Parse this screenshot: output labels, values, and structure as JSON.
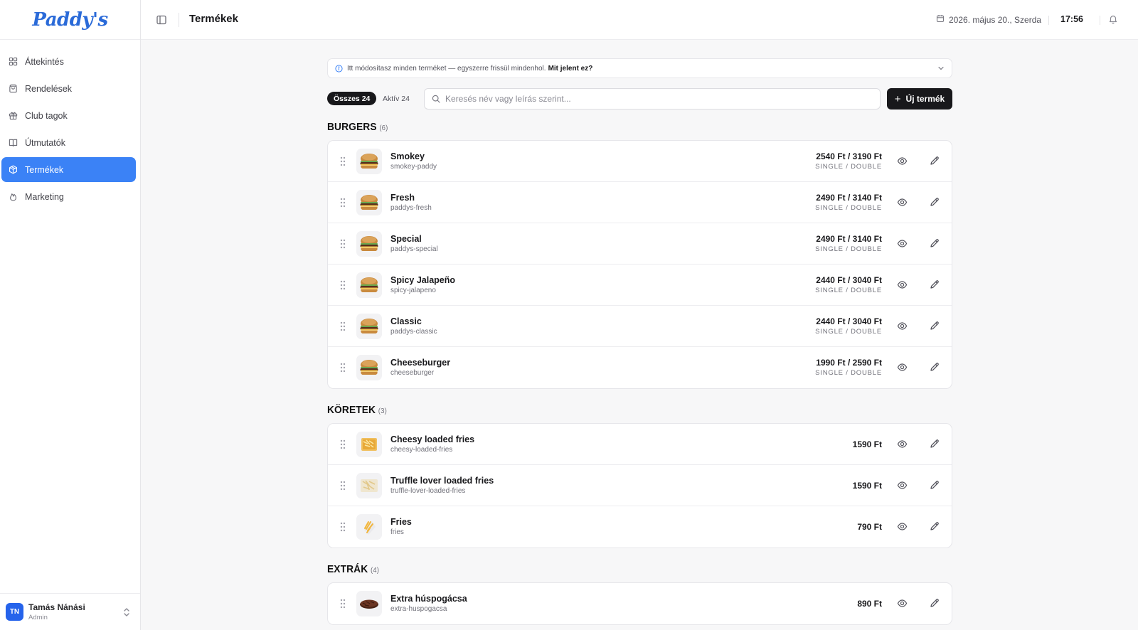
{
  "app": {
    "logo": "Paddy's"
  },
  "sidebar": {
    "items": [
      {
        "label": "Áttekintés",
        "icon": "dashboard-icon",
        "active": false
      },
      {
        "label": "Rendelések",
        "icon": "shopping-bag-icon",
        "active": false
      },
      {
        "label": "Club tagok",
        "icon": "gift-icon",
        "active": false
      },
      {
        "label": "Útmutatók",
        "icon": "book-icon",
        "active": false
      },
      {
        "label": "Termékek",
        "icon": "package-icon",
        "active": true
      },
      {
        "label": "Marketing",
        "icon": "flame-icon",
        "active": false
      }
    ]
  },
  "user": {
    "initials": "TN",
    "name": "Tamás Nánási",
    "role": "Admin"
  },
  "header": {
    "title": "Termékek",
    "date": "2026. május 20., Szerda",
    "time": "17:56"
  },
  "banner": {
    "text": "Itt módosítasz minden terméket — egyszerre frissül mindenhol.",
    "link": "Mit jelent ez?"
  },
  "filters": {
    "all": "Összes 24",
    "active": "Aktív 24"
  },
  "search": {
    "placeholder": "Keresés név vagy leírás szerint..."
  },
  "new_button": {
    "label": "Új termék"
  },
  "sections": [
    {
      "title": "BURGERS",
      "count": "(6)",
      "products": [
        {
          "name": "Smokey",
          "slug": "smokey-paddy",
          "price": "2540 Ft / 3190 Ft",
          "sub": "SINGLE / DOUBLE",
          "thumb": "burger"
        },
        {
          "name": "Fresh",
          "slug": "paddys-fresh",
          "price": "2490 Ft / 3140 Ft",
          "sub": "SINGLE / DOUBLE",
          "thumb": "burger"
        },
        {
          "name": "Special",
          "slug": "paddys-special",
          "price": "2490 Ft / 3140 Ft",
          "sub": "SINGLE / DOUBLE",
          "thumb": "burger"
        },
        {
          "name": "Spicy Jalapeño",
          "slug": "spicy-jalapeno",
          "price": "2440 Ft / 3040 Ft",
          "sub": "SINGLE / DOUBLE",
          "thumb": "burger"
        },
        {
          "name": "Classic",
          "slug": "paddys-classic",
          "price": "2440 Ft / 3040 Ft",
          "sub": "SINGLE / DOUBLE",
          "thumb": "burger"
        },
        {
          "name": "Cheeseburger",
          "slug": "cheeseburger",
          "price": "1990 Ft / 2590 Ft",
          "sub": "SINGLE / DOUBLE",
          "thumb": "burger"
        }
      ]
    },
    {
      "title": "KÖRETEK",
      "count": "(3)",
      "products": [
        {
          "name": "Cheesy loaded fries",
          "slug": "cheesy-loaded-fries",
          "price": "1590 Ft",
          "sub": "",
          "thumb": "loaded-fries"
        },
        {
          "name": "Truffle lover loaded fries",
          "slug": "truffle-lover-loaded-fries",
          "price": "1590 Ft",
          "sub": "",
          "thumb": "truffle-fries"
        },
        {
          "name": "Fries",
          "slug": "fries",
          "price": "790 Ft",
          "sub": "",
          "thumb": "fries"
        }
      ]
    },
    {
      "title": "EXTRÁK",
      "count": "(4)",
      "products": [
        {
          "name": "Extra húspogácsa",
          "slug": "extra-huspogacsa",
          "price": "890 Ft",
          "sub": "",
          "thumb": "patty"
        }
      ]
    }
  ],
  "colors": {
    "accent": "#3b82f6",
    "dark": "#18181b"
  }
}
